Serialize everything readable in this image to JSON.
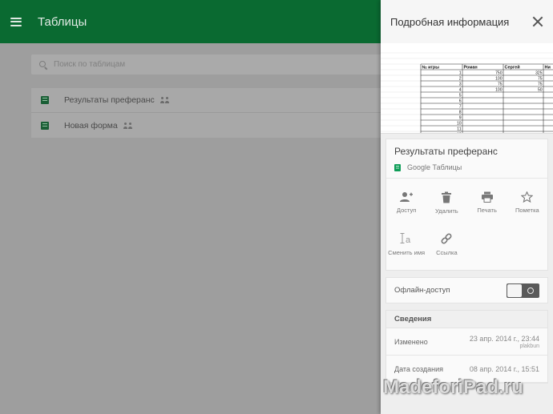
{
  "appbar": {
    "title": "Таблицы"
  },
  "search": {
    "placeholder": "Поиск по таблицам"
  },
  "files": [
    {
      "name": "Результаты преферанс",
      "shared": true
    },
    {
      "name": "Новая форма",
      "shared": true
    }
  ],
  "panel": {
    "title": "Подробная информация",
    "preview": {
      "headers": [
        "№ игры",
        "Роман",
        "Сергей",
        "Ни"
      ],
      "rows": [
        [
          "1",
          "750",
          "325",
          ""
        ],
        [
          "2",
          "100",
          "75",
          ""
        ],
        [
          "3",
          "75",
          "75",
          ""
        ],
        [
          "4",
          "100",
          "50",
          ""
        ],
        [
          "5",
          "",
          "",
          ""
        ],
        [
          "6",
          "",
          "",
          ""
        ],
        [
          "7",
          "",
          "",
          ""
        ],
        [
          "8",
          "",
          "",
          ""
        ],
        [
          "9",
          "",
          "",
          ""
        ],
        [
          "10",
          "",
          "",
          ""
        ],
        [
          "11",
          "",
          "",
          ""
        ],
        [
          "12",
          "",
          "",
          ""
        ]
      ]
    },
    "doc_title": "Результаты преферанс",
    "doc_type": "Google Таблицы",
    "actions": {
      "share": "Доступ",
      "delete": "Удалить",
      "print": "Печать",
      "star": "Пометка",
      "rename": "Сменить имя",
      "link": "Ссылка"
    },
    "offline_label": "Офлайн-доступ",
    "info": {
      "title": "Сведения",
      "modified_label": "Изменено",
      "modified_value": "23 апр. 2014 г., 23:44",
      "modified_by": "plakbun",
      "created_label": "Дата создания",
      "created_value": "08 апр. 2014 г., 15:51"
    }
  },
  "watermark": "MadeforiPad.ru",
  "colors": {
    "appbar": "#0a6a31",
    "sheet_green": "#0f9d58"
  }
}
